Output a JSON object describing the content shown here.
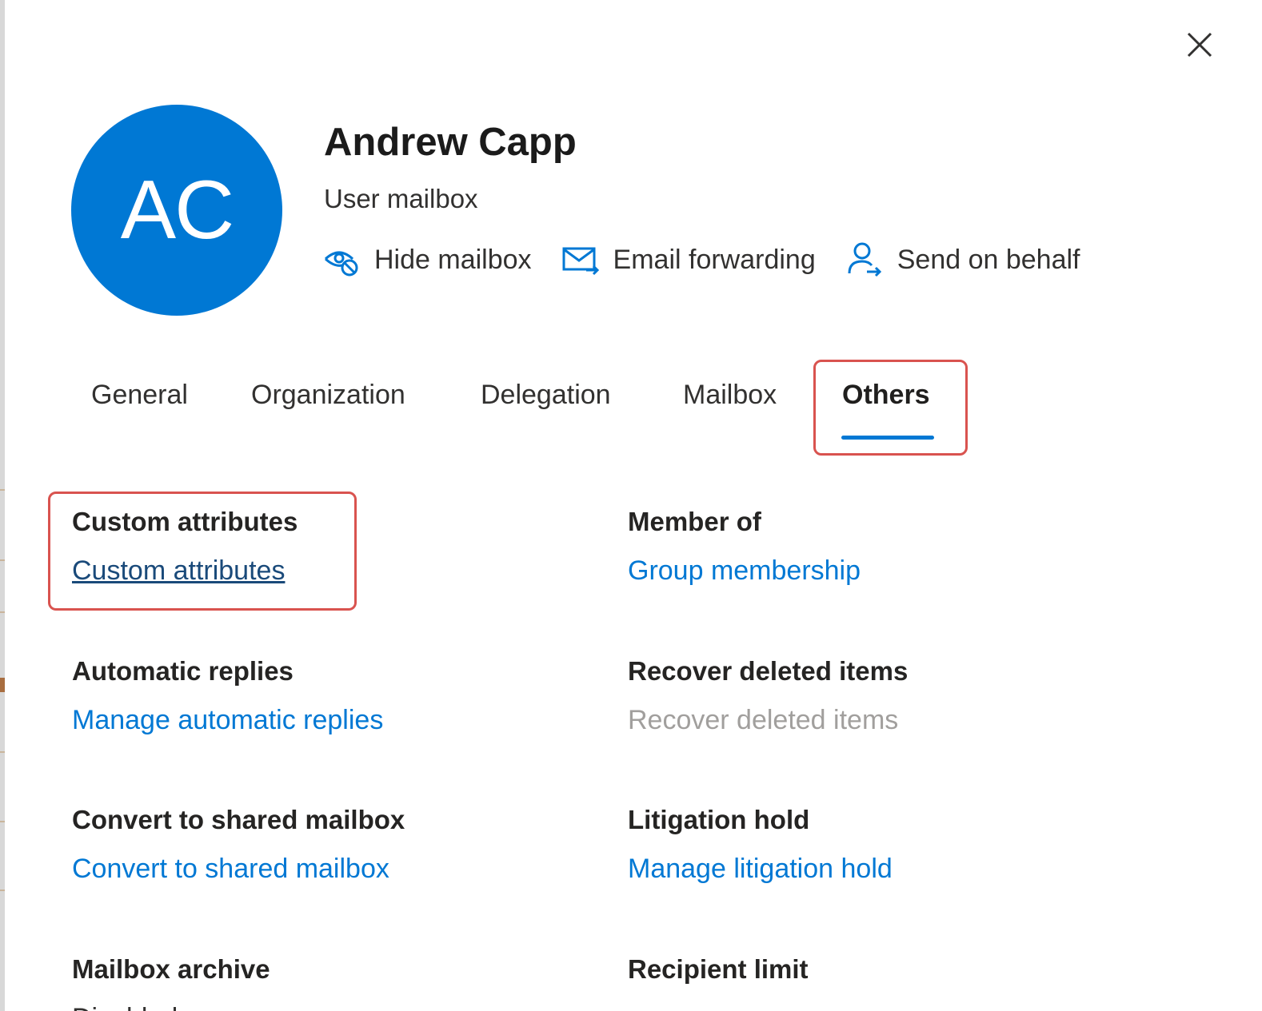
{
  "header": {
    "initials": "AC",
    "name": "Andrew Capp",
    "mailbox_type": "User mailbox",
    "avatar_color": "#0078d4",
    "actions": [
      {
        "label": "Hide mailbox",
        "icon": "eye-hide-icon"
      },
      {
        "label": "Email forwarding",
        "icon": "mail-forward-icon"
      },
      {
        "label": "Send on behalf",
        "icon": "person-arrow-icon"
      }
    ]
  },
  "close_icon": "close-icon",
  "tabs": [
    {
      "label": "General",
      "active": false
    },
    {
      "label": "Organization",
      "active": false
    },
    {
      "label": "Delegation",
      "active": false
    },
    {
      "label": "Mailbox",
      "active": false
    },
    {
      "label": "Others",
      "active": true
    }
  ],
  "sections": {
    "custom_attributes": {
      "heading": "Custom attributes",
      "link": "Custom attributes"
    },
    "member_of": {
      "heading": "Member of",
      "link": "Group membership"
    },
    "automatic_replies": {
      "heading": "Automatic replies",
      "link": "Manage automatic replies"
    },
    "recover_deleted": {
      "heading": "Recover deleted items",
      "link": "Recover deleted items",
      "disabled": true
    },
    "convert_shared": {
      "heading": "Convert to shared mailbox",
      "link": "Convert to shared mailbox"
    },
    "litigation_hold": {
      "heading": "Litigation hold",
      "link": "Manage litigation hold"
    },
    "mailbox_archive": {
      "heading": "Mailbox archive",
      "value": "Disabled"
    },
    "recipient_limit": {
      "heading": "Recipient limit"
    }
  },
  "colors": {
    "accent": "#0078d4",
    "highlight": "#d9534f",
    "disabled_text": "#a19f9d"
  }
}
